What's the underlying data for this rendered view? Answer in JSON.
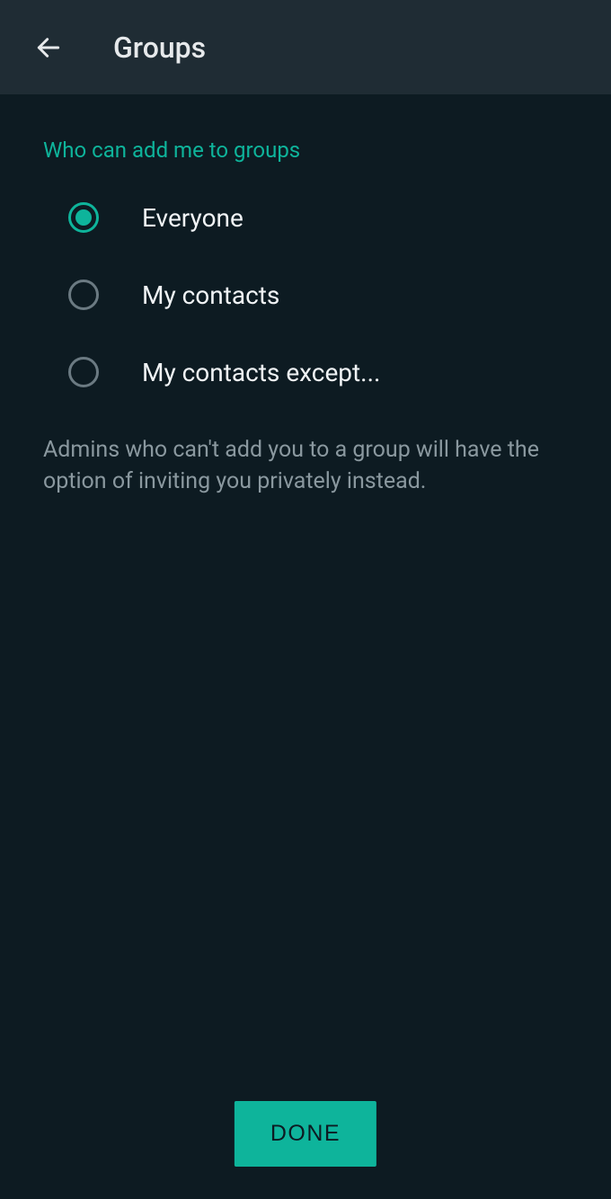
{
  "header": {
    "title": "Groups"
  },
  "section": {
    "title": "Who can add me to groups"
  },
  "options": [
    {
      "label": "Everyone",
      "selected": true
    },
    {
      "label": "My contacts",
      "selected": false
    },
    {
      "label": "My contacts except...",
      "selected": false
    }
  ],
  "description": "Admins who can't add you to a group will have the option of inviting you privately instead.",
  "buttons": {
    "done": "DONE"
  }
}
